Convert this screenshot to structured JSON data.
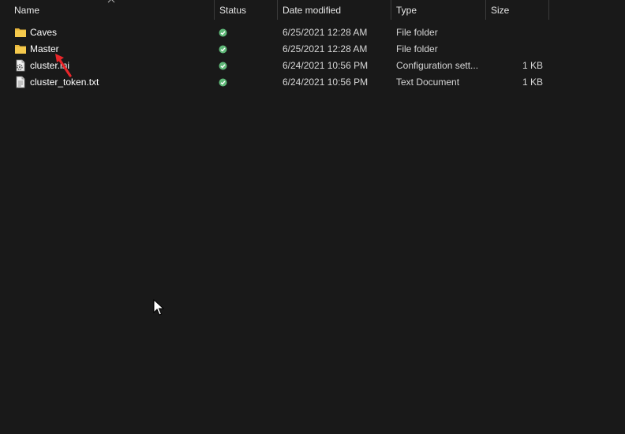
{
  "header": {
    "columns": [
      {
        "label": "Name"
      },
      {
        "label": "Status"
      },
      {
        "label": "Date modified"
      },
      {
        "label": "Type"
      },
      {
        "label": "Size"
      }
    ],
    "sort_icon": "chevron-up-icon"
  },
  "files": [
    {
      "name": "Caves",
      "icon": "folder-icon",
      "status": "synced-check-icon",
      "date": "6/25/2021 12:28 AM",
      "type": "File folder",
      "size": ""
    },
    {
      "name": "Master",
      "icon": "folder-icon",
      "status": "synced-check-icon",
      "date": "6/25/2021 12:28 AM",
      "type": "File folder",
      "size": ""
    },
    {
      "name": "cluster.ini",
      "icon": "config-file-icon",
      "status": "synced-check-icon",
      "date": "6/24/2021 10:56 PM",
      "type": "Configuration sett...",
      "size": "1 KB"
    },
    {
      "name": "cluster_token.txt",
      "icon": "text-file-icon",
      "status": "synced-check-icon",
      "date": "6/24/2021 10:56 PM",
      "type": "Text Document",
      "size": "1 KB"
    }
  ],
  "colors": {
    "background": "#191919",
    "folder": "#f5c94c",
    "status_green": "#5fb878",
    "annotation_red": "#e8262a"
  },
  "overlays": {
    "annotation": "red-arrow-icon",
    "pointer": "mouse-cursor-icon"
  }
}
